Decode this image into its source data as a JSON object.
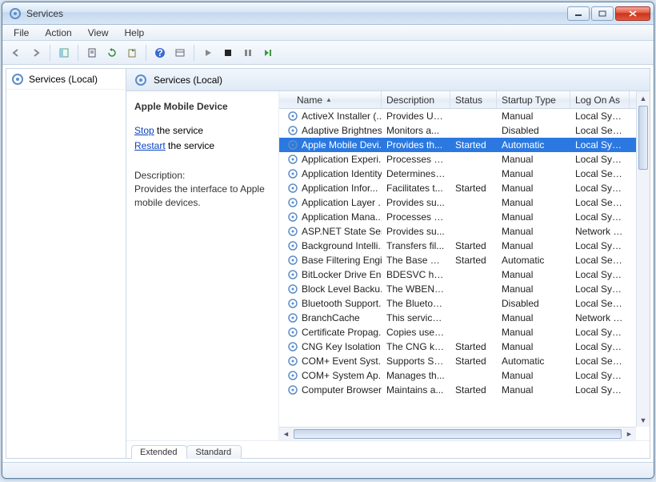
{
  "window": {
    "title": "Services"
  },
  "menubar": [
    "File",
    "Action",
    "View",
    "Help"
  ],
  "left_pane": {
    "root": "Services (Local)"
  },
  "right_header": {
    "title": "Services (Local)"
  },
  "detail": {
    "service_name": "Apple Mobile Device",
    "stop_link": "Stop",
    "stop_suffix": " the service",
    "restart_link": "Restart",
    "restart_suffix": " the service",
    "desc_label": "Description:",
    "desc": "Provides the interface to Apple mobile devices."
  },
  "columns": [
    "Name",
    "Description",
    "Status",
    "Startup Type",
    "Log On As"
  ],
  "tabs": {
    "extended": "Extended",
    "standard": "Standard",
    "active": "extended"
  },
  "services": [
    {
      "name": "ActiveX Installer (...",
      "desc": "Provides Us...",
      "status": "",
      "startup": "Manual",
      "logon": "Local Syste..."
    },
    {
      "name": "Adaptive Brightness",
      "desc": "Monitors a...",
      "status": "",
      "startup": "Disabled",
      "logon": "Local Servic..."
    },
    {
      "name": "Apple Mobile Devi...",
      "desc": "Provides th...",
      "status": "Started",
      "startup": "Automatic",
      "logon": "Local Syste...",
      "selected": true
    },
    {
      "name": "Application Experi...",
      "desc": "Processes a...",
      "status": "",
      "startup": "Manual",
      "logon": "Local Syste..."
    },
    {
      "name": "Application Identity",
      "desc": "Determines ...",
      "status": "",
      "startup": "Manual",
      "logon": "Local Servic..."
    },
    {
      "name": "Application Infor...",
      "desc": "Facilitates t...",
      "status": "Started",
      "startup": "Manual",
      "logon": "Local Syste..."
    },
    {
      "name": "Application Layer ...",
      "desc": "Provides su...",
      "status": "",
      "startup": "Manual",
      "logon": "Local Servic..."
    },
    {
      "name": "Application Mana...",
      "desc": "Processes in...",
      "status": "",
      "startup": "Manual",
      "logon": "Local Syste..."
    },
    {
      "name": "ASP.NET State Ser...",
      "desc": "Provides su...",
      "status": "",
      "startup": "Manual",
      "logon": "Network S..."
    },
    {
      "name": "Background Intelli...",
      "desc": "Transfers fil...",
      "status": "Started",
      "startup": "Manual",
      "logon": "Local Syste..."
    },
    {
      "name": "Base Filtering Engi...",
      "desc": "The Base Fil...",
      "status": "Started",
      "startup": "Automatic",
      "logon": "Local Servic..."
    },
    {
      "name": "BitLocker Drive En...",
      "desc": "BDESVC hos...",
      "status": "",
      "startup": "Manual",
      "logon": "Local Syste..."
    },
    {
      "name": "Block Level Backu...",
      "desc": "The WBENG...",
      "status": "",
      "startup": "Manual",
      "logon": "Local Syste..."
    },
    {
      "name": "Bluetooth Support...",
      "desc": "The Bluetoo...",
      "status": "",
      "startup": "Disabled",
      "logon": "Local Servic..."
    },
    {
      "name": "BranchCache",
      "desc": "This service ...",
      "status": "",
      "startup": "Manual",
      "logon": "Network S..."
    },
    {
      "name": "Certificate Propag...",
      "desc": "Copies user ...",
      "status": "",
      "startup": "Manual",
      "logon": "Local Syste..."
    },
    {
      "name": "CNG Key Isolation",
      "desc": "The CNG ke...",
      "status": "Started",
      "startup": "Manual",
      "logon": "Local Syste..."
    },
    {
      "name": "COM+ Event Syst...",
      "desc": "Supports Sy...",
      "status": "Started",
      "startup": "Automatic",
      "logon": "Local Servic..."
    },
    {
      "name": "COM+ System Ap...",
      "desc": "Manages th...",
      "status": "",
      "startup": "Manual",
      "logon": "Local Syste..."
    },
    {
      "name": "Computer Browser",
      "desc": "Maintains a...",
      "status": "Started",
      "startup": "Manual",
      "logon": "Local Syste..."
    }
  ]
}
